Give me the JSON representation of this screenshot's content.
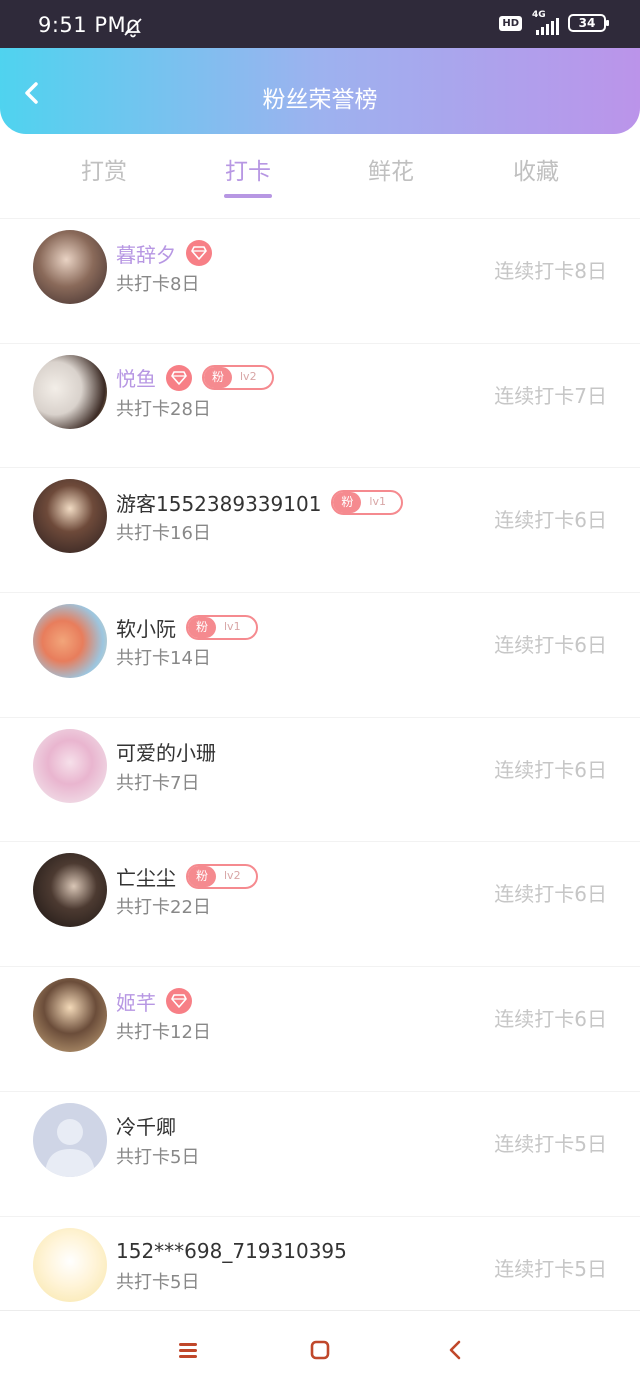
{
  "status_bar": {
    "time": "9:51 PM",
    "hd": "HD",
    "network": "4G",
    "battery": "34"
  },
  "header": {
    "title": "粉丝荣誉榜",
    "back_icon": "chevron-left-icon"
  },
  "tabs": [
    {
      "label": "打赏",
      "active": false
    },
    {
      "label": "打卡",
      "active": true
    },
    {
      "label": "鲜花",
      "active": false
    },
    {
      "label": "收藏",
      "active": false
    }
  ],
  "rows": [
    {
      "name": "暮辞夕",
      "sub": "共打卡8日",
      "right": "连续打卡8日",
      "vip": true,
      "fan": null
    },
    {
      "name": "悦鱼",
      "sub": "共打卡28日",
      "right": "连续打卡7日",
      "vip": true,
      "fan": {
        "label": "粉",
        "level": "lv2"
      }
    },
    {
      "name": "游客1552389339101",
      "sub": "共打卡16日",
      "right": "连续打卡6日",
      "vip": false,
      "fan": {
        "label": "粉",
        "level": "lv1"
      }
    },
    {
      "name": "软小阮",
      "sub": "共打卡14日",
      "right": "连续打卡6日",
      "vip": false,
      "fan": {
        "label": "粉",
        "level": "lv1"
      }
    },
    {
      "name": "可爱的小珊",
      "sub": "共打卡7日",
      "right": "连续打卡6日",
      "vip": false,
      "fan": null
    },
    {
      "name": "亡尘尘",
      "sub": "共打卡22日",
      "right": "连续打卡6日",
      "vip": false,
      "fan": {
        "label": "粉",
        "level": "lv2"
      }
    },
    {
      "name": "姬芊",
      "sub": "共打卡12日",
      "right": "连续打卡6日",
      "vip": true,
      "fan": null
    },
    {
      "name": "冷千卿",
      "sub": "共打卡5日",
      "right": "连续打卡5日",
      "vip": false,
      "fan": null
    },
    {
      "name": "152***698_719310395",
      "sub": "共打卡5日",
      "right": "连续打卡5日",
      "vip": false,
      "fan": null
    }
  ],
  "colors": {
    "accent": "#b797e3",
    "badge": "#f58a8f",
    "header_gradient": [
      "#4fd3ef",
      "#bb94ea"
    ]
  }
}
